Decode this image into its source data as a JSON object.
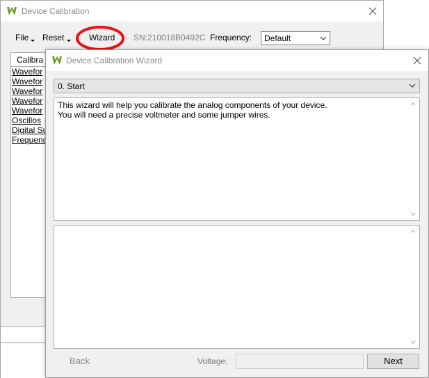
{
  "main_window": {
    "title": "Device Calibration",
    "menu": {
      "file": "File",
      "reset": "Reset",
      "wizard": "Wizard",
      "serial": "SN:210018B0492C",
      "frequency_label": "Frequency:",
      "frequency_value": "Default"
    },
    "tab_label": "Calibra",
    "items": [
      "Wavefor",
      "Wavefor",
      "Wavefor",
      "Wavefor",
      "Wavefor",
      "Oscillos",
      "Digital Su",
      "Frequenc"
    ]
  },
  "wizard": {
    "title": "Device Calibration Wizard",
    "step_value": "0. Start",
    "intro_lines": [
      "This wizard will help you calibrate the analog components of your device.",
      "You will need a precise voltmeter and some jumper wires."
    ],
    "back_label": "Back",
    "voltage_label": "Voltage:",
    "voltage_value": "",
    "next_label": "Next"
  },
  "colors": {
    "logo": "#6a9a24",
    "highlight": "#e8131b"
  },
  "icons": [
    "app-logo-icon",
    "close-icon",
    "chevron-down-icon",
    "scroll-up-icon",
    "scroll-down-icon"
  ]
}
